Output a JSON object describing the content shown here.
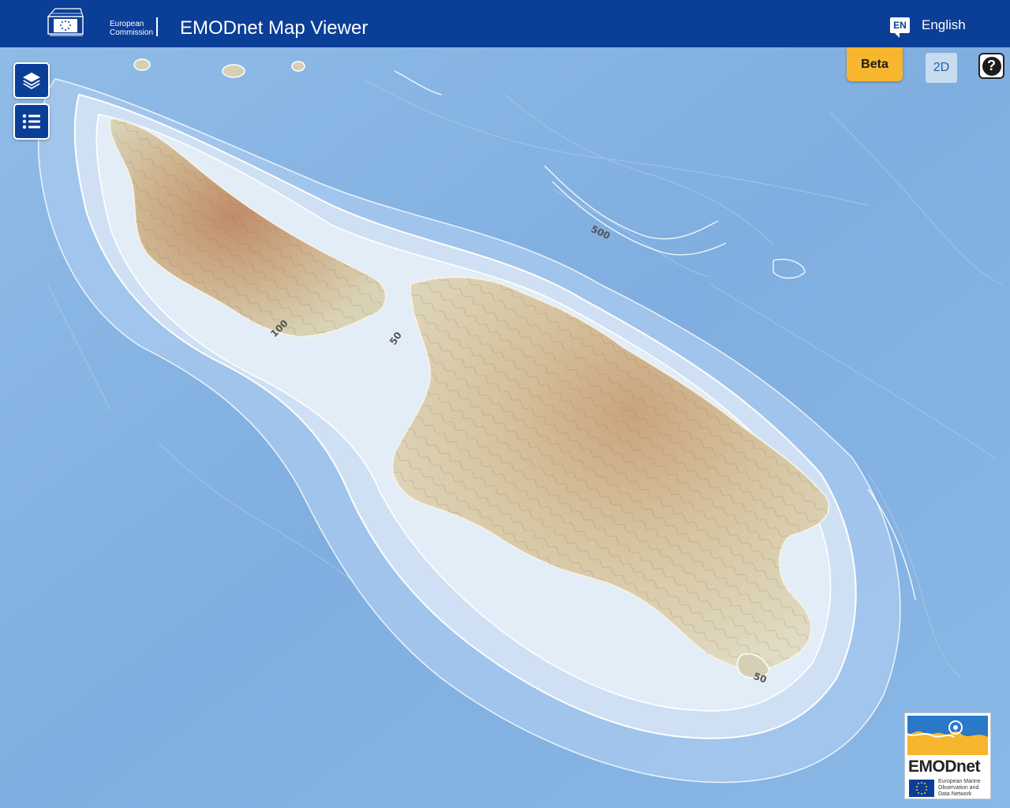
{
  "header": {
    "org_line1": "European",
    "org_line2": "Commission",
    "title": "EMODnet Map Viewer",
    "lang_code": "EN",
    "lang_label": "English"
  },
  "controls": {
    "beta_label": "Beta",
    "mode_label": "2D",
    "help_label": "?"
  },
  "map": {
    "contours": [
      "500",
      "100",
      "50",
      "50"
    ]
  },
  "logo": {
    "name": "EMODnet",
    "sub_line1": "European Marine",
    "sub_line2": "Observation and",
    "sub_line3": "Data Network"
  },
  "icons": {
    "layers": "layers-icon",
    "list": "list-icon",
    "help": "help-icon",
    "language": "speech-bubble-icon"
  },
  "colors": {
    "header_bg": "#0b3e96",
    "beta_bg": "#f6b62d",
    "sea": "#7fb2e3",
    "shelf": "#dbe8f6",
    "land_low": "#e4ddc2",
    "land_high": "#b99873"
  }
}
